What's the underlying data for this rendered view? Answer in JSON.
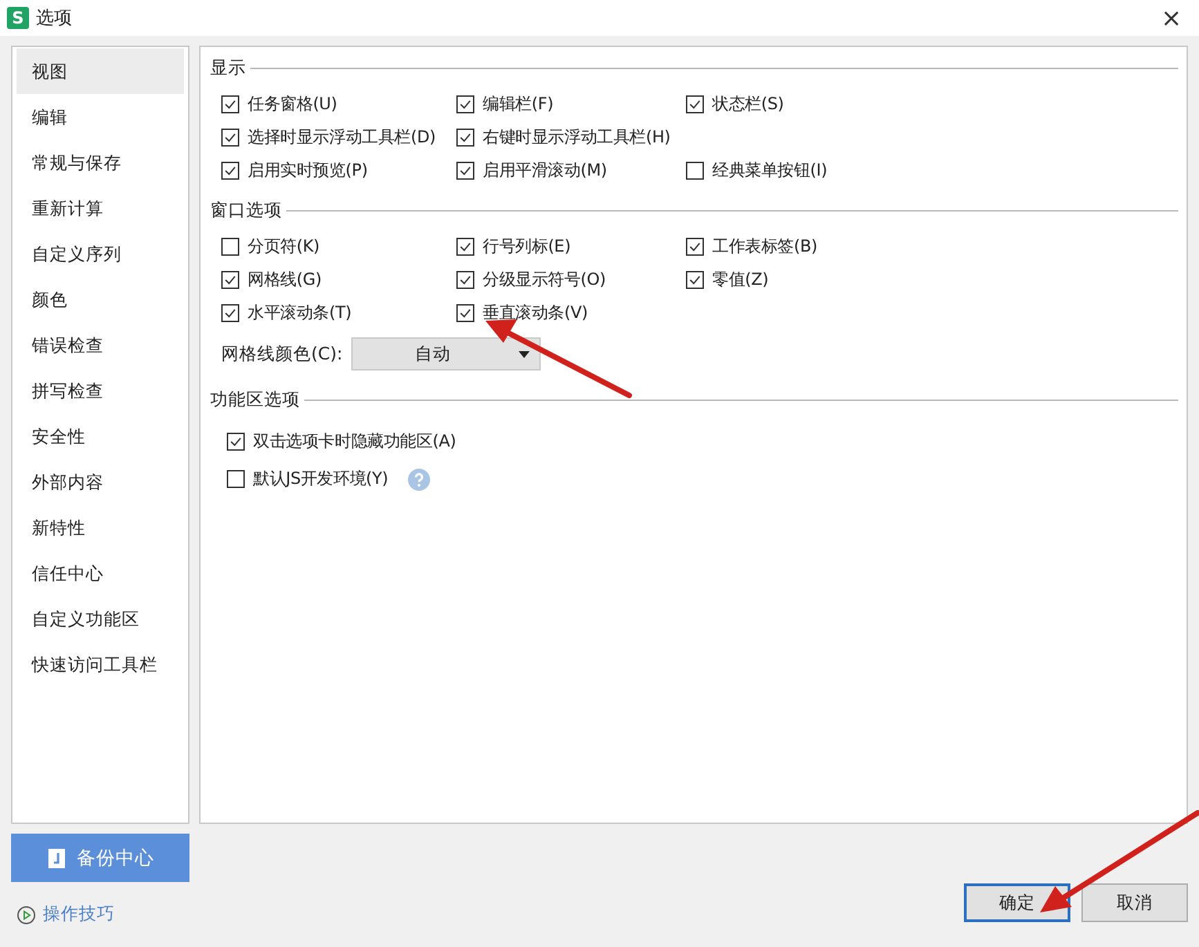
{
  "window": {
    "title": "选项",
    "app_badge": "S",
    "close": "×"
  },
  "sidebar": {
    "items": [
      {
        "label": "视图",
        "selected": true
      },
      {
        "label": "编辑",
        "selected": false
      },
      {
        "label": "常规与保存",
        "selected": false
      },
      {
        "label": "重新计算",
        "selected": false
      },
      {
        "label": "自定义序列",
        "selected": false
      },
      {
        "label": "颜色",
        "selected": false
      },
      {
        "label": "错误检查",
        "selected": false
      },
      {
        "label": "拼写检查",
        "selected": false
      },
      {
        "label": "安全性",
        "selected": false
      },
      {
        "label": "外部内容",
        "selected": false
      },
      {
        "label": "新特性",
        "selected": false
      },
      {
        "label": "信任中心",
        "selected": false
      },
      {
        "label": "自定义功能区",
        "selected": false
      },
      {
        "label": "快速访问工具栏",
        "selected": false
      }
    ]
  },
  "backup_button": "备份中心",
  "tips_link": "操作技巧",
  "sections": [
    {
      "title": "显示",
      "kind": "grid",
      "rows": [
        [
          {
            "label": "任务窗格(U)",
            "checked": true
          },
          {
            "label": "编辑栏(F)",
            "checked": true
          },
          {
            "label": "状态栏(S)",
            "checked": true
          }
        ],
        [
          {
            "label": "选择时显示浮动工具栏(D)",
            "checked": true
          },
          {
            "label": "右键时显示浮动工具栏(H)",
            "checked": true
          }
        ],
        [
          {
            "label": "启用实时预览(P)",
            "checked": true
          },
          {
            "label": "启用平滑滚动(M)",
            "checked": true
          },
          {
            "label": "经典菜单按钮(I)",
            "checked": false
          }
        ]
      ]
    },
    {
      "title": "窗口选项",
      "kind": "grid",
      "rows": [
        [
          {
            "label": "分页符(K)",
            "checked": false
          },
          {
            "label": "行号列标(E)",
            "checked": true
          },
          {
            "label": "工作表标签(B)",
            "checked": true
          }
        ],
        [
          {
            "label": "网格线(G)",
            "checked": true
          },
          {
            "label": "分级显示符号(O)",
            "checked": true
          },
          {
            "label": "零值(Z)",
            "checked": true
          }
        ],
        [
          {
            "label": "水平滚动条(T)",
            "checked": true
          },
          {
            "label": "垂直滚动条(V)",
            "checked": true
          }
        ]
      ],
      "dropdown": {
        "label": "网格线颜色(C):",
        "value": "自动"
      }
    },
    {
      "title": "功能区选项",
      "kind": "list",
      "options": [
        {
          "label": "双击选项卡时隐藏功能区(A)",
          "checked": true
        },
        {
          "label": "默认JS开发环境(Y)",
          "checked": false,
          "help": true
        }
      ]
    }
  ],
  "buttons": [
    {
      "label": "确定",
      "selected": true
    },
    {
      "label": "取消",
      "selected": false
    }
  ]
}
